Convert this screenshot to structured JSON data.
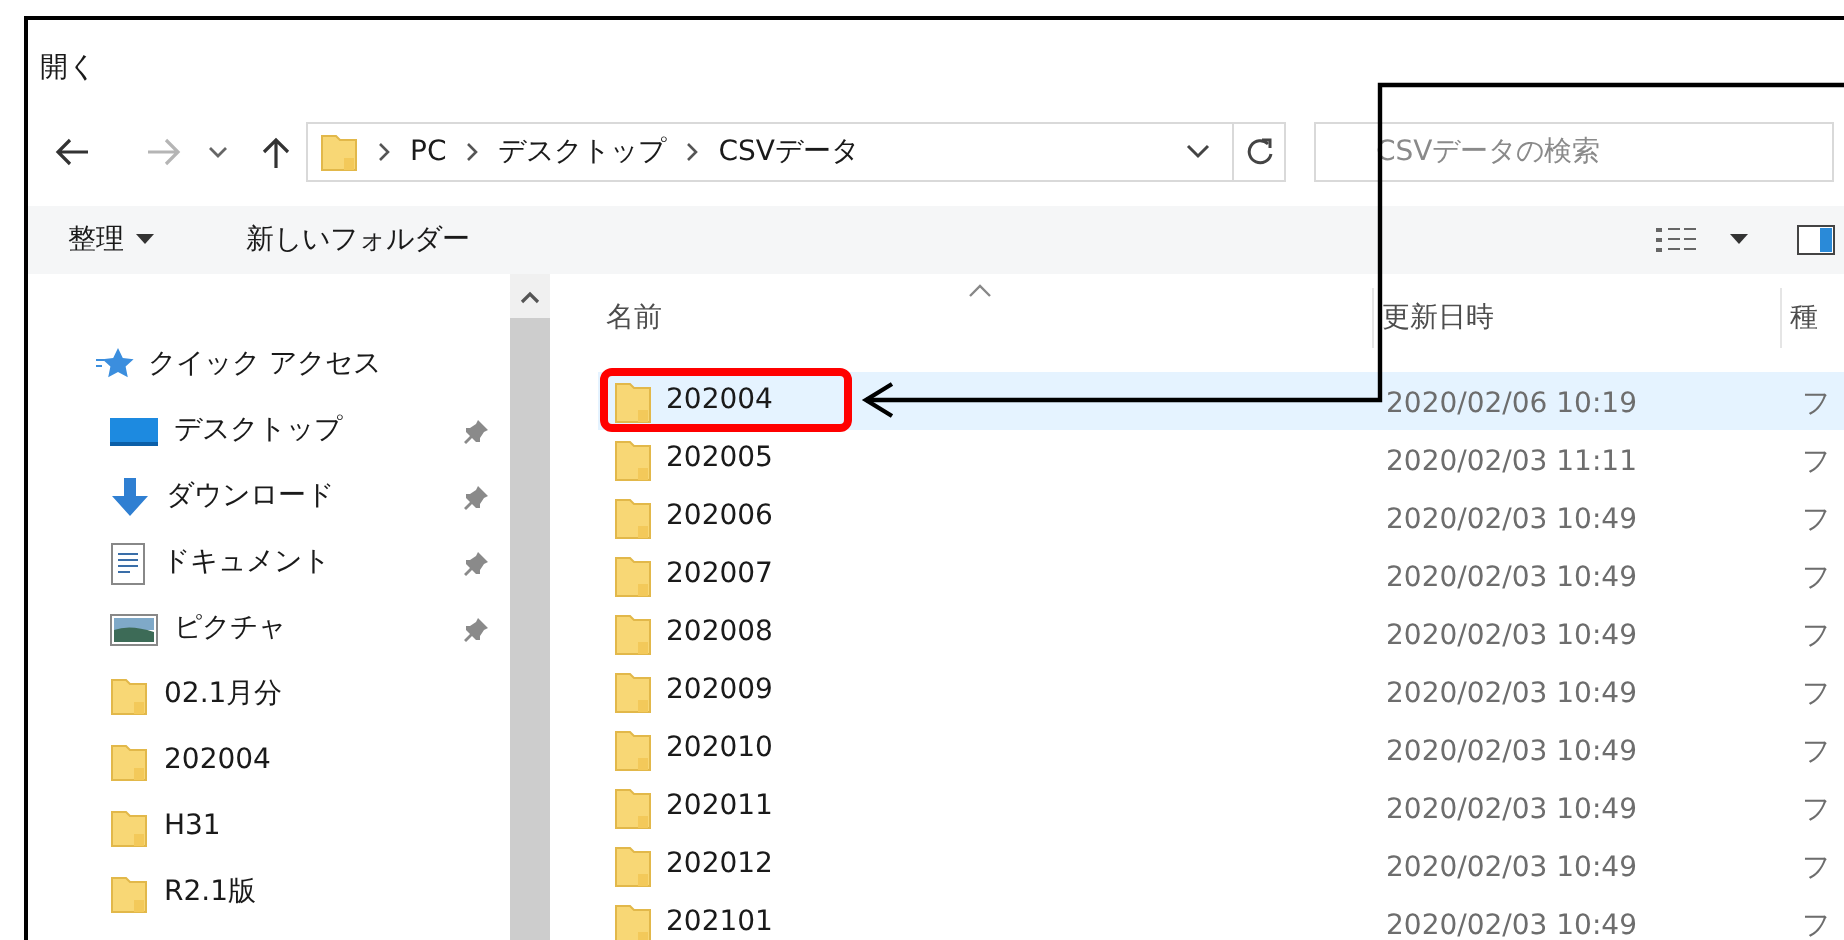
{
  "window": {
    "title": "開く"
  },
  "address_bar": {
    "segments": [
      "PC",
      "デスクトップ",
      "CSVデータ"
    ]
  },
  "search": {
    "placeholder": "CSVデータの検索"
  },
  "toolbar": {
    "organize": "整理",
    "new_folder": "新しいフォルダー"
  },
  "sidebar": {
    "quick_access": "クイック アクセス",
    "items": [
      {
        "label": "デスクトップ",
        "kind": "desktop",
        "pinned": true
      },
      {
        "label": "ダウンロード",
        "kind": "download",
        "pinned": true
      },
      {
        "label": "ドキュメント",
        "kind": "document",
        "pinned": true
      },
      {
        "label": "ピクチャ",
        "kind": "picture",
        "pinned": true
      },
      {
        "label": "02.1月分",
        "kind": "folder",
        "pinned": false
      },
      {
        "label": "202004",
        "kind": "folder",
        "pinned": false
      },
      {
        "label": "H31",
        "kind": "folder",
        "pinned": false
      },
      {
        "label": "R2.1版",
        "kind": "folder",
        "pinned": false
      }
    ]
  },
  "file_list": {
    "columns": [
      "名前",
      "更新日時",
      "種"
    ],
    "rows": [
      {
        "name": "202004",
        "modified": "2020/02/06 10:19",
        "column_3": "フ",
        "selected": true,
        "annotated": true
      },
      {
        "name": "202005",
        "modified": "2020/02/03 11:11",
        "column_3": "フ",
        "selected": false,
        "annotated": false
      },
      {
        "name": "202006",
        "modified": "2020/02/03 10:49",
        "column_3": "フ",
        "selected": false,
        "annotated": false
      },
      {
        "name": "202007",
        "modified": "2020/02/03 10:49",
        "column_3": "フ",
        "selected": false,
        "annotated": false
      },
      {
        "name": "202008",
        "modified": "2020/02/03 10:49",
        "column_3": "フ",
        "selected": false,
        "annotated": false
      },
      {
        "name": "202009",
        "modified": "2020/02/03 10:49",
        "column_3": "フ",
        "selected": false,
        "annotated": false
      },
      {
        "name": "202010",
        "modified": "2020/02/03 10:49",
        "column_3": "フ",
        "selected": false,
        "annotated": false
      },
      {
        "name": "202011",
        "modified": "2020/02/03 10:49",
        "column_3": "フ",
        "selected": false,
        "annotated": false
      },
      {
        "name": "202012",
        "modified": "2020/02/03 10:49",
        "column_3": "フ",
        "selected": false,
        "annotated": false
      },
      {
        "name": "202101",
        "modified": "2020/02/03 10:49",
        "column_3": "フ",
        "selected": false,
        "annotated": false
      }
    ]
  }
}
